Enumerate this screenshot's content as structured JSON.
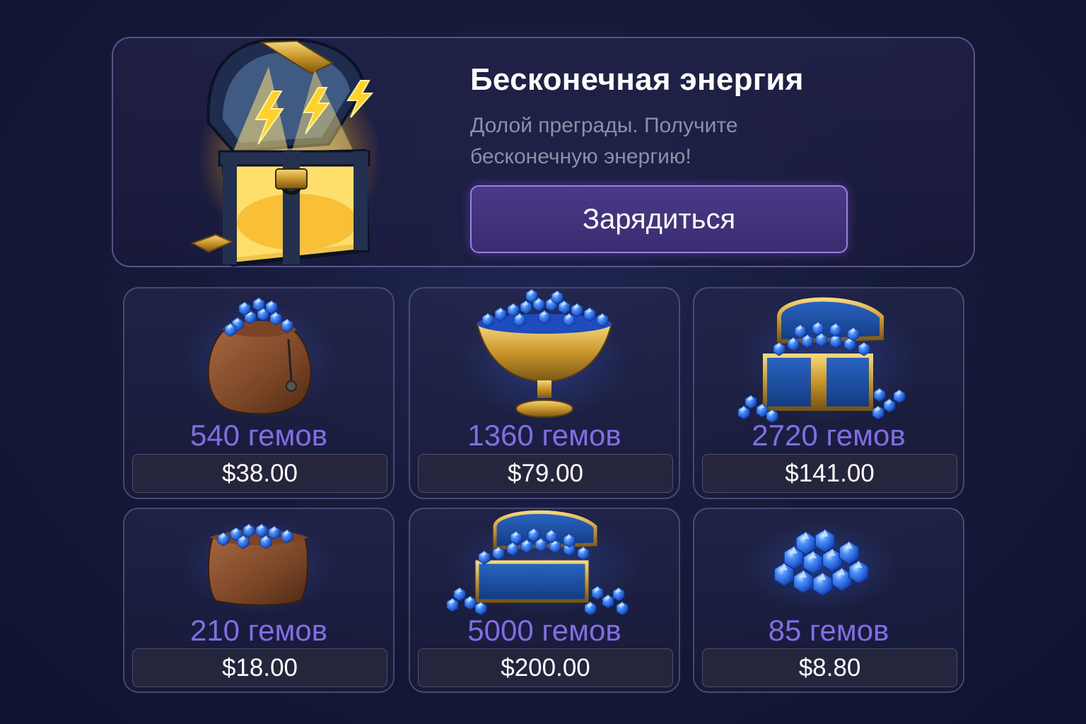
{
  "banner": {
    "title": "Бесконечная энергия",
    "description_line1": "Долой преграды. Получите",
    "description_line2": "бесконечную энергию!",
    "button_label": "Зарядиться",
    "icon": "glowing-treasure-chest-icon"
  },
  "packs": [
    {
      "gems_label": "540 гемов",
      "price": "$38.00",
      "icon": "gem-sack-icon"
    },
    {
      "gems_label": "1360 гемов",
      "price": "$79.00",
      "icon": "gem-chalice-icon"
    },
    {
      "gems_label": "2720 гемов",
      "price": "$141.00",
      "icon": "gem-chest-icon"
    },
    {
      "gems_label": "210 гемов",
      "price": "$18.00",
      "icon": "gem-pouch-icon"
    },
    {
      "gems_label": "5000 гемов",
      "price": "$200.00",
      "icon": "gem-chest-pile-icon"
    },
    {
      "gems_label": "85 гемов",
      "price": "$8.80",
      "icon": "gem-pile-icon"
    }
  ],
  "colors": {
    "gem_label": "#7f6ee6",
    "button_border": "#9b7de6",
    "gem_blue": "#2f6ee0",
    "gold": "#d4a72c"
  }
}
